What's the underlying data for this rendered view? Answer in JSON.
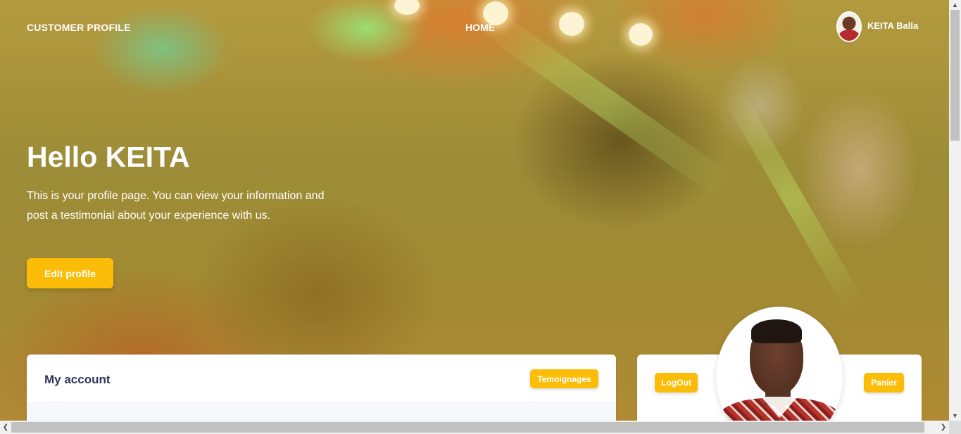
{
  "nav": {
    "brand": "CUSTOMER PROFILE",
    "home": "HOME",
    "user_name": "KEITA Balla"
  },
  "hero": {
    "title": "Hello KEITA",
    "description": "This is your profile page. You can view your information and post a testimonial about your experience with us.",
    "edit_button": "Edit profile"
  },
  "account_card": {
    "title": "My account",
    "testimonials_button": "Temoignages"
  },
  "profile_card": {
    "logout_button": "LogOut",
    "cart_button": "Panier"
  },
  "colors": {
    "accent": "#fbbd08",
    "heading": "#32325d"
  }
}
